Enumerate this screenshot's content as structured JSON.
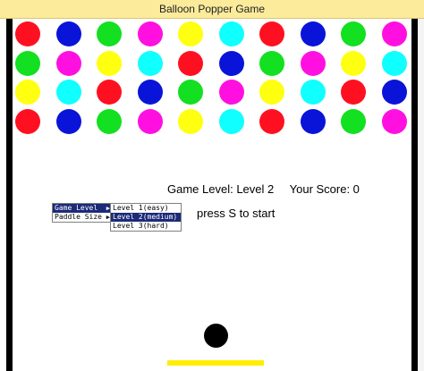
{
  "window": {
    "title": "Balloon Popper Game"
  },
  "colors": {
    "red": "#ff1020",
    "blue": "#0a14d8",
    "green": "#12e020",
    "magenta": "#ff10e0",
    "yellow": "#ffff10",
    "cyan": "#10ffff",
    "titlebar": "#fbeb9b",
    "menu_selected": "#1c2a78",
    "paddle": "#ffee00",
    "ball": "#000000"
  },
  "balloons": [
    [
      "red",
      "blue",
      "green",
      "magenta",
      "yellow",
      "cyan",
      "red",
      "blue",
      "green",
      "magenta"
    ],
    [
      "green",
      "magenta",
      "yellow",
      "cyan",
      "red",
      "blue",
      "green",
      "magenta",
      "yellow",
      "cyan"
    ],
    [
      "yellow",
      "cyan",
      "red",
      "blue",
      "green",
      "magenta",
      "yellow",
      "cyan",
      "red",
      "blue"
    ],
    [
      "red",
      "blue",
      "green",
      "magenta",
      "yellow",
      "cyan",
      "red",
      "blue",
      "green",
      "magenta"
    ]
  ],
  "status": {
    "level_text": "Game Level: Level 2",
    "score_text": "Your Score: 0"
  },
  "prompt": "press S to start",
  "menu": {
    "items": [
      {
        "label": "Game Level",
        "selected": true
      },
      {
        "label": "Paddle Size",
        "selected": false
      }
    ],
    "submenu": [
      {
        "label": "Level 1(easy)",
        "selected": false
      },
      {
        "label": "Level 2(medium)",
        "selected": true
      },
      {
        "label": "Level 3(hard)",
        "selected": false
      }
    ]
  }
}
